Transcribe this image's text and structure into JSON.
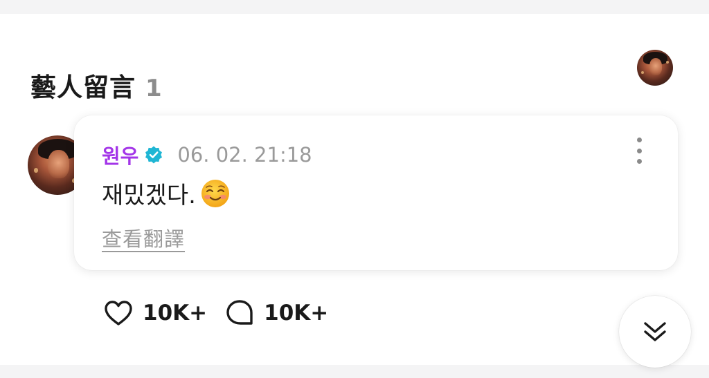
{
  "section": {
    "title": "藝人留言",
    "count": "1",
    "header_avatar_icon": "artist-avatar"
  },
  "comment": {
    "author": "원우",
    "verified_icon": "verified-badge-icon",
    "timestamp": "06. 02. 21:18",
    "text": "재밌겠다.",
    "emoji": "smiling-face-emoji",
    "translate_label": "查看翻譯",
    "more_icon": "more-vertical-icon"
  },
  "actions": {
    "likes_icon": "heart-icon",
    "likes": "10K+",
    "replies_icon": "comment-bubble-icon",
    "replies": "10K+"
  },
  "scroll_button_icon": "double-chevron-down-icon",
  "colors": {
    "author": "#a335e8",
    "verified": "#1fb6d4",
    "muted": "#9a9a9a",
    "text": "#1a1a1a"
  }
}
